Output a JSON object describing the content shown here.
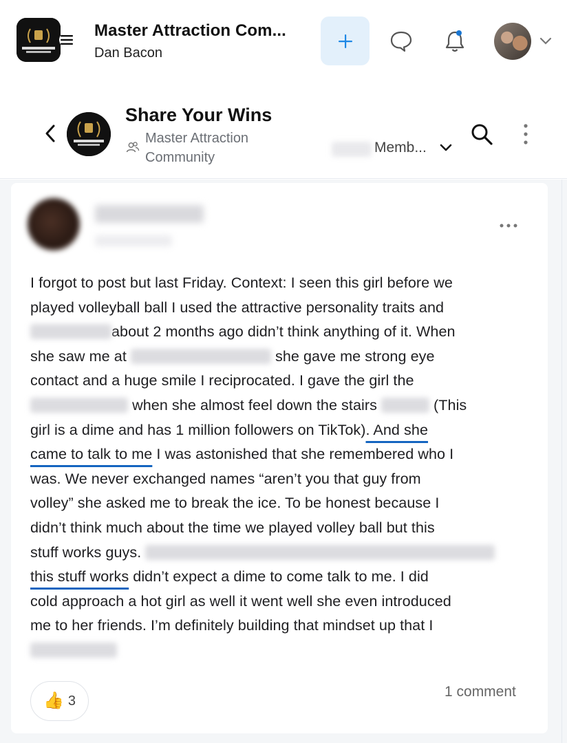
{
  "app": {
    "title": "Master Attraction Com...",
    "subtitle": "Dan Bacon"
  },
  "icons": {
    "menu": "hamburger-menu-icon",
    "plus": "plus-icon",
    "chat": "chat-bubble-icon",
    "bell": "bell-icon",
    "chevron": "chevron-down-icon",
    "back": "chevron-left-icon",
    "search": "search-icon",
    "more": "more-vertical-icon",
    "people": "people-icon",
    "thumbs_up": "thumbs-up-icon"
  },
  "colors": {
    "accent": "#1565c0",
    "plus_button_bg": "#e3f0fb",
    "notification_dot": "#1976d2"
  },
  "group": {
    "title": "Share Your Wins",
    "community": "Master Attraction Community",
    "members_label": "Memb..."
  },
  "post": {
    "lines": [
      {
        "a": "I forgot to post but last Friday. Context: I seen this girl before we"
      },
      {
        "a": "played volleyball ball I used the attractive personality traits and"
      },
      {
        "b": "about 2 months ago didn’t think anything of it. When"
      },
      {
        "a": "she saw me at ",
        "b": "she gave me strong eye"
      },
      {
        "a": "contact and a huge smile I reciprocated. I gave the girl the"
      },
      {
        "b": "when she almost feel down the stairs ",
        "c": " (This"
      },
      {
        "a": "girl is a dime and has 1 million followers on TikTok)",
        "u": ". And she"
      },
      {
        "u": "came to talk to me",
        "a": " I was astonished that she remembered who I"
      },
      {
        "a": "was. We never exchanged names “aren’t you that guy from"
      },
      {
        "a": "volley” she asked me to break the ice. To be honest because I"
      },
      {
        "a": "didn’t think much about the time we played volley ball but this"
      },
      {
        "a": "stuff works guys. "
      },
      {
        "u": "this stuff works",
        "a": " didn’t expect a dime to come talk to me. I did"
      },
      {
        "a": "cold approach a hot girl as well it went well she even introduced"
      },
      {
        "a": "me to her friends. I’m definitely building that mindset up that I"
      }
    ],
    "reaction_emoji": "👍",
    "reaction_count": "3",
    "comments_label": "1 comment"
  }
}
